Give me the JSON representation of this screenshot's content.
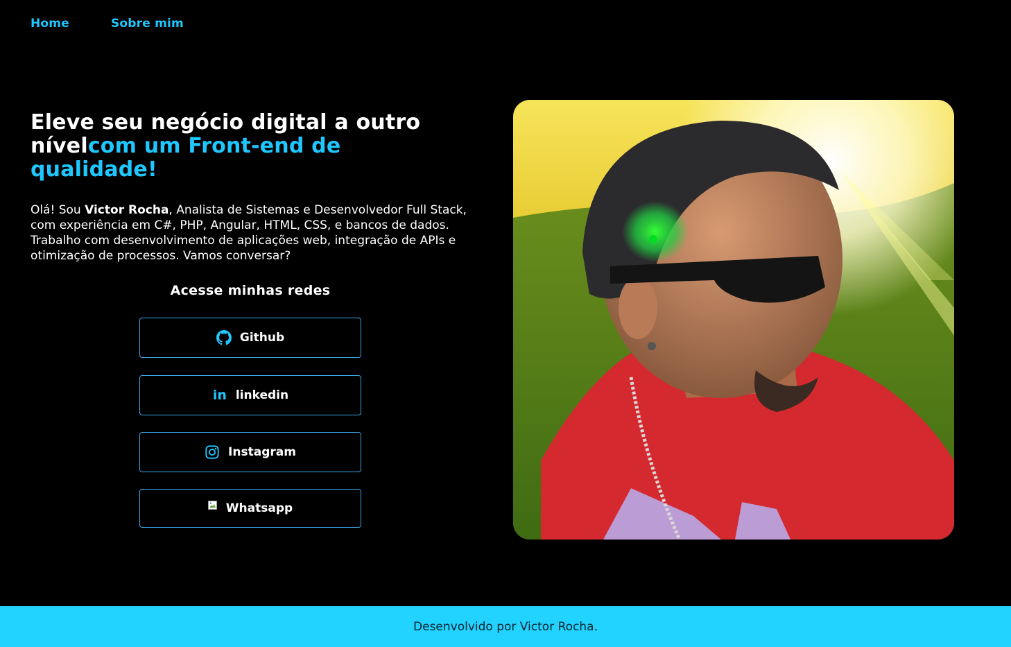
{
  "nav": {
    "home": "Home",
    "about": "Sobre mim"
  },
  "hero": {
    "title_white": "Eleve seu negócio digital a outro nível",
    "title_accent": "com um Front-end de qualidade!",
    "intro_before": "Olá! Sou ",
    "intro_name": "Victor Rocha",
    "intro_after": ", Analista de Sistemas e Desenvolvedor Full Stack, com experiência em C#, PHP, Angular, HTML, CSS, e bancos de dados. Trabalho com desenvolvimento de aplicações web, integração de APIs e otimização de processos. Vamos conversar?"
  },
  "social": {
    "heading": "Acesse minhas redes",
    "github": {
      "label": "Github",
      "icon": "github-icon"
    },
    "linkedin": {
      "label": "linkedin",
      "icon": "linkedin-icon",
      "glyph": "in"
    },
    "instagram": {
      "label": "Instagram",
      "icon": "instagram-icon"
    },
    "whatsapp": {
      "label": "Whatsapp",
      "icon": "broken-image-icon"
    }
  },
  "footer": {
    "text": "Desenvolvido por Victor Rocha."
  },
  "colors": {
    "background": "#000000",
    "accent": "#1ec8ff",
    "button_border": "#3aa8e8",
    "footer_bg": "#22d3ff",
    "footer_text": "#0b2430",
    "text": "#ffffff"
  }
}
